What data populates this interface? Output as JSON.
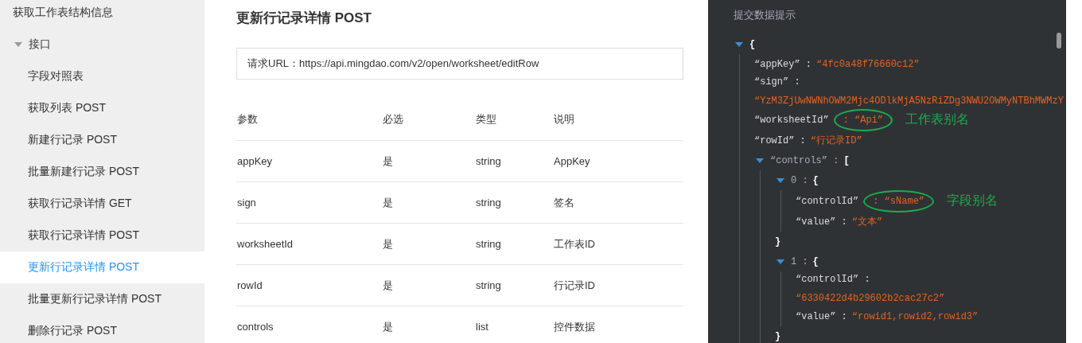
{
  "sidebar": {
    "items": [
      {
        "label": "获取工作表结构信息",
        "selected": false
      },
      {
        "label": "接口",
        "expanded": true,
        "selected": false,
        "children": [
          {
            "label": "字段对照表",
            "selected": false
          },
          {
            "label": "获取列表 POST",
            "selected": false
          },
          {
            "label": "新建行记录 POST",
            "selected": false
          },
          {
            "label": "批量新建行记录 POST",
            "selected": false
          },
          {
            "label": "获取行记录详情 GET",
            "selected": false
          },
          {
            "label": "获取行记录详情 POST",
            "selected": false
          },
          {
            "label": "更新行记录详情 POST",
            "selected": true
          },
          {
            "label": "批量更新行记录详情 POST",
            "selected": false
          },
          {
            "label": "删除行记录 POST",
            "selected": false
          }
        ]
      }
    ]
  },
  "main": {
    "title": "更新行记录详情 POST",
    "request_url": "请求URL：https://api.mingdao.com/v2/open/worksheet/editRow",
    "table": {
      "columns": [
        "参数",
        "必选",
        "类型",
        "说明"
      ],
      "rows": [
        [
          "appKey",
          "是",
          "string",
          "AppKey"
        ],
        [
          "sign",
          "是",
          "string",
          "签名"
        ],
        [
          "worksheetId",
          "是",
          "string",
          "工作表ID"
        ],
        [
          "rowId",
          "是",
          "string",
          "行记录ID"
        ],
        [
          "controls",
          "是",
          "list",
          "控件数据"
        ]
      ]
    }
  },
  "preview": {
    "title": "提交数据提示",
    "root": {
      "kind": "object",
      "expanded": true,
      "open": "{",
      "children": [
        {
          "kind": "pair",
          "key": "“appKey” :",
          "value": "“4fc0a48f76660c12”"
        },
        {
          "kind": "pair",
          "key": "“sign” :",
          "value": "“YzM3ZjUwNWNhOWM2Mjc4ODlkMjA5NzRiZDg3NWU2OWMyNTBhMWMzY",
          "wrap": true
        },
        {
          "kind": "pair",
          "key": "“worksheetId”",
          "value": ": “Api”",
          "circled": true,
          "note": "工作表别名"
        },
        {
          "kind": "pair",
          "key": "“rowId” :",
          "value": "“行记录ID”"
        },
        {
          "kind": "object",
          "key": "“controls” :",
          "expanded": true,
          "open": "[",
          "children": [
            {
              "kind": "object",
              "key": "0 :",
              "expanded": true,
              "open": "{",
              "close": "}",
              "children": [
                {
                  "kind": "pair",
                  "key": "“controlId”",
                  "value": ": “sName”",
                  "circled": true,
                  "note": "字段别名"
                },
                {
                  "kind": "pair",
                  "key": "“value” :",
                  "value": "“文本”"
                }
              ]
            },
            {
              "kind": "object",
              "key": "1 :",
              "expanded": true,
              "open": "{",
              "close": "}",
              "children": [
                {
                  "kind": "pair",
                  "key": "“controlId” :",
                  "value": "“6330422d4b29602b2cac27c2”",
                  "wrap": true
                },
                {
                  "kind": "pair",
                  "key": "“value” :",
                  "value": "“rowid1,rowid2,rowid3”"
                }
              ]
            }
          ]
        }
      ]
    }
  }
}
